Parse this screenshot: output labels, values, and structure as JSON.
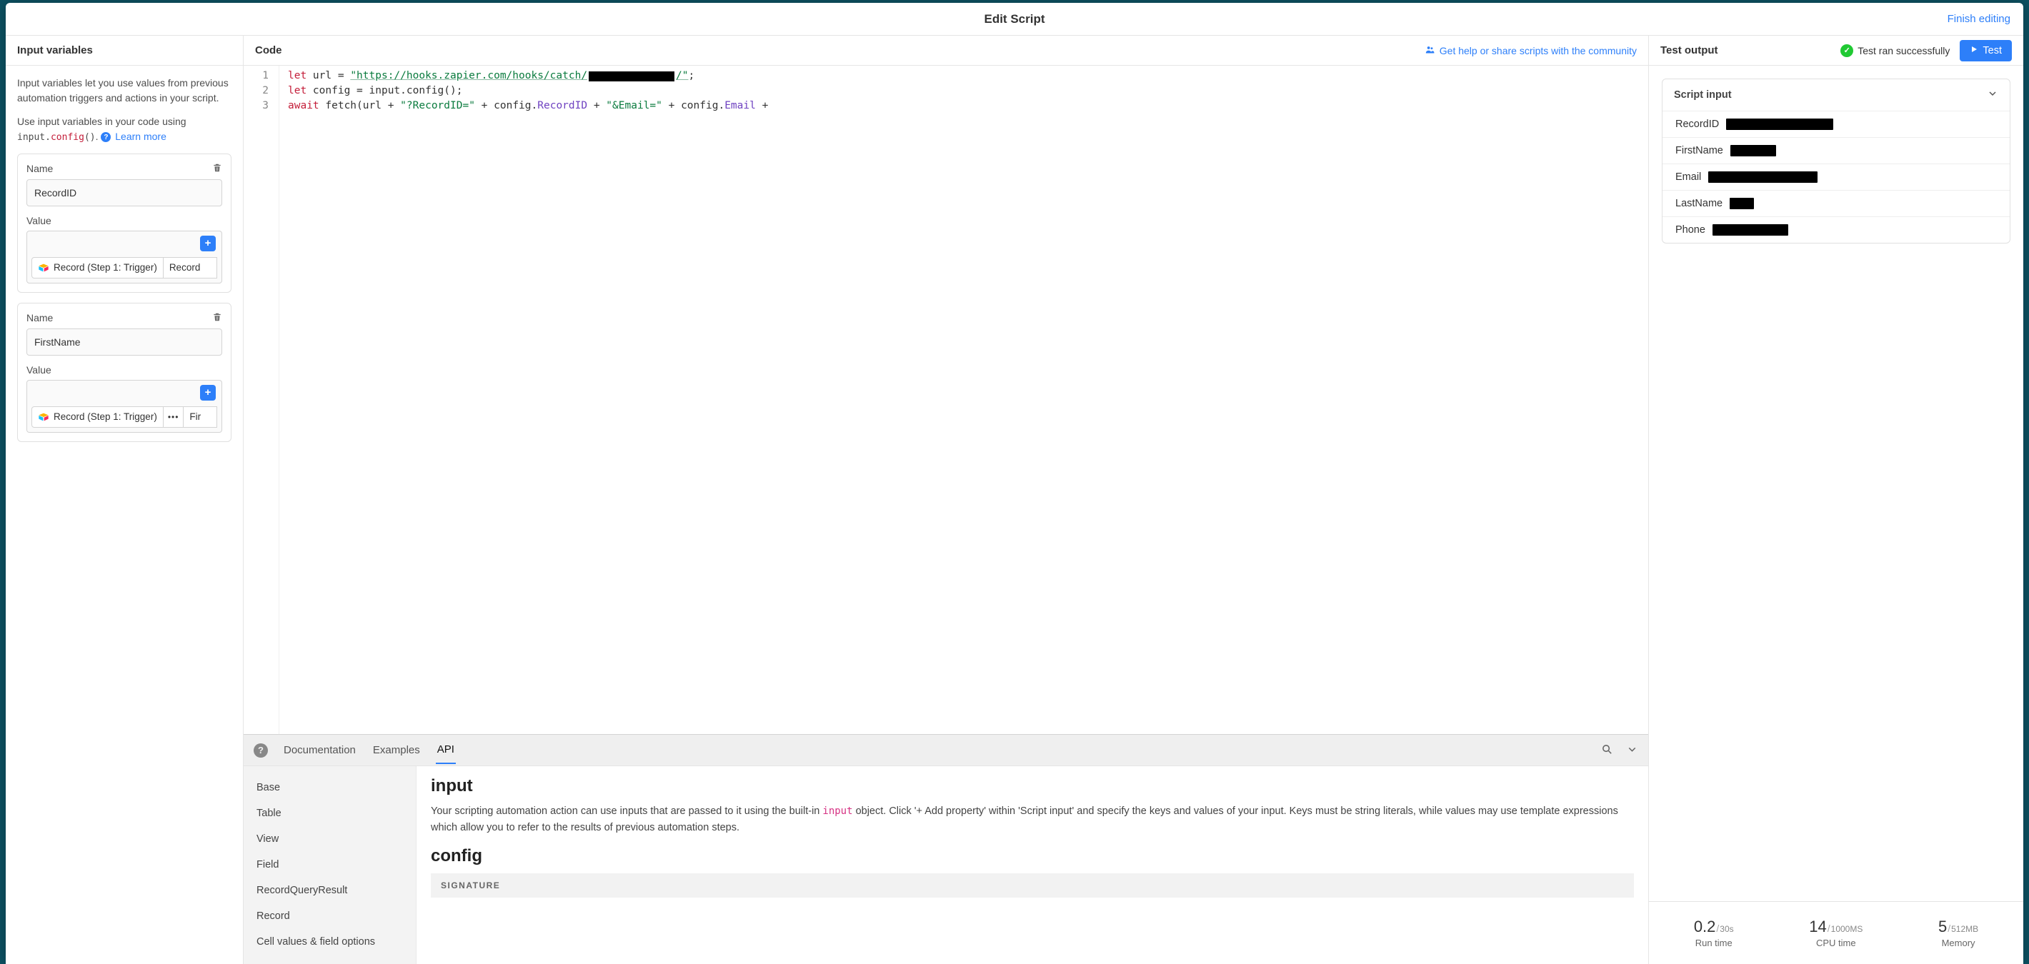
{
  "title": "Edit Script",
  "finish": "Finish editing",
  "left": {
    "heading": "Input variables",
    "help1": "Input variables let you use values from previous automation triggers and actions in your script.",
    "help2_pre": "Use input variables in your code using ",
    "help2_code_a": "input.",
    "help2_code_b": "config",
    "help2_code_c": "()",
    "learn": "Learn more",
    "name_label": "Name",
    "value_label": "Value",
    "chip_source": "Record (Step 1: Trigger)",
    "vars": [
      {
        "name": "RecordID",
        "col": "Record"
      },
      {
        "name": "FirstName",
        "col": "Fir"
      }
    ]
  },
  "code": {
    "heading": "Code",
    "share": "Get help or share scripts with the community",
    "line1_a": "let",
    "line1_b": " url = ",
    "line1_url": "\"https://hooks.zapier.com/hooks/catch/",
    "line1_end": "/\"",
    "line1_semi": ";",
    "line2_a": "let",
    "line2_b": " config = input.config();",
    "line3_a": "await",
    "line3_b": " fetch",
    "line3_c": "(",
    "line3_d": "url + ",
    "line3_s1": "\"?RecordID=\"",
    "line3_e": " + config.",
    "line3_p1": "RecordID",
    "line3_f": " + ",
    "line3_s2": "\"&Email=\"",
    "line3_g": " + config.",
    "line3_p2": "Email",
    "line3_h": " +"
  },
  "docs": {
    "tab_doc": "Documentation",
    "tab_ex": "Examples",
    "tab_api": "API",
    "nav": [
      "Base",
      "Table",
      "View",
      "Field",
      "RecordQueryResult",
      "Record",
      "Cell values & field options"
    ],
    "h_input": "input",
    "p_input_a": "Your scripting automation action can use inputs that are passed to it using the built-in ",
    "p_input_code": "input",
    "p_input_b": " object. Click '+ Add property' within 'Script input' and specify the keys and values of your input. Keys must be string literals, while values may use template expressions which allow you to refer to the results of previous automation steps.",
    "h_config": "config",
    "sig": "SIGNATURE"
  },
  "right": {
    "heading": "Test output",
    "status": "Test ran successfully",
    "test_btn": "Test",
    "si_title": "Script input",
    "rows": [
      {
        "key": "RecordID",
        "w": 150
      },
      {
        "key": "FirstName",
        "w": 64
      },
      {
        "key": "Email",
        "w": 153
      },
      {
        "key": "LastName",
        "w": 34
      },
      {
        "key": "Phone",
        "w": 106
      }
    ],
    "metrics": {
      "run_val": "0.2",
      "run_max": "30s",
      "run_label": "Run time",
      "cpu_val": "14",
      "cpu_max": "1000MS",
      "cpu_label": "CPU time",
      "mem_val": "5",
      "mem_max": "512MB",
      "mem_label": "Memory"
    }
  }
}
